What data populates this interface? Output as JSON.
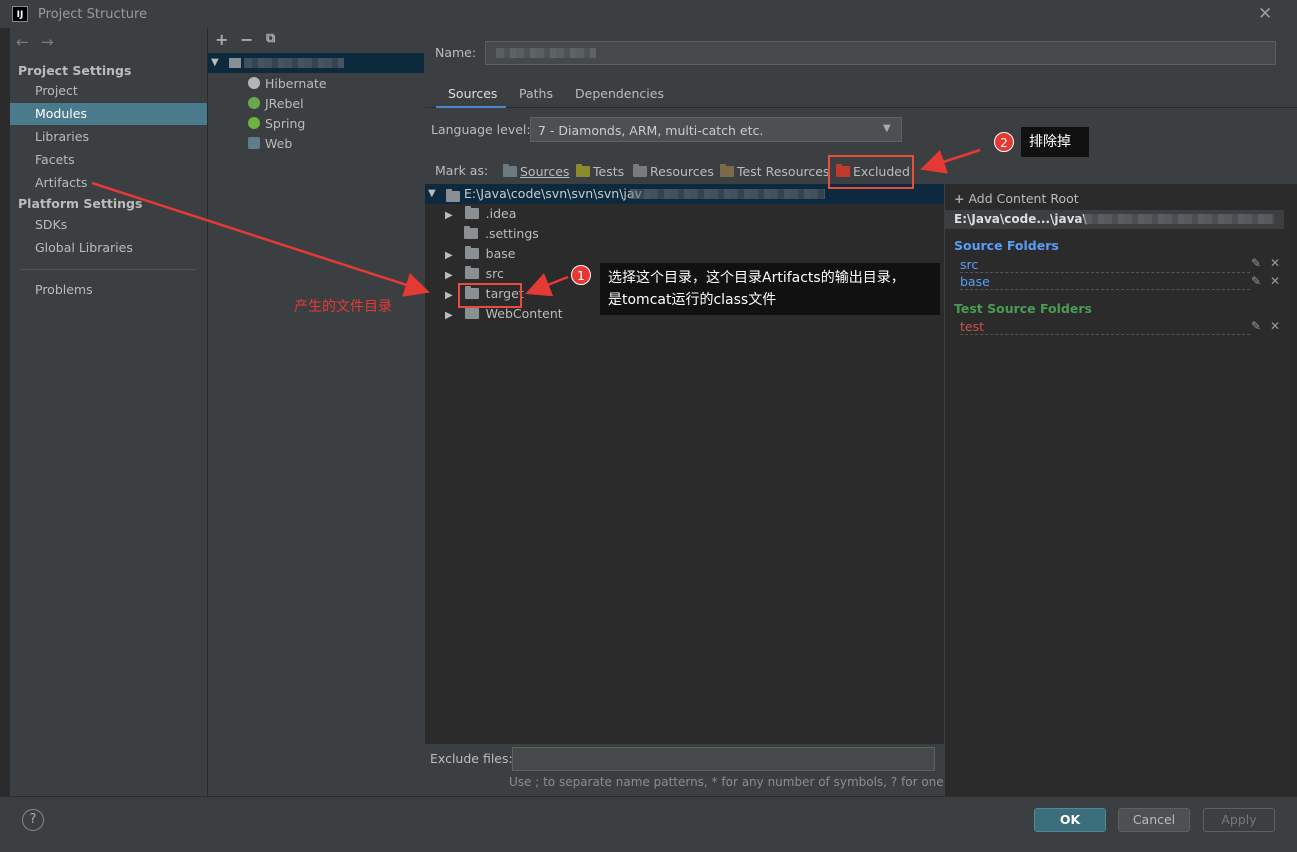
{
  "window": {
    "title": "Project Structure",
    "logo_text": "IJ",
    "close_glyph": "✕"
  },
  "nav": {
    "back_glyph": "←",
    "forward_glyph": "→",
    "project_settings_header": "Project Settings",
    "project_items": [
      "Project",
      "Modules",
      "Libraries",
      "Facets",
      "Artifacts"
    ],
    "platform_settings_header": "Platform Settings",
    "platform_items": [
      "SDKs",
      "Global Libraries"
    ],
    "problems": "Problems",
    "selected": "Modules"
  },
  "modules_panel": {
    "add_glyph": "+",
    "remove_glyph": "−",
    "copy_glyph": "⧉",
    "facets": [
      "Hibernate",
      "JRebel",
      "Spring",
      "Web"
    ]
  },
  "details": {
    "name_label": "Name:",
    "tabs": [
      "Sources",
      "Paths",
      "Dependencies"
    ],
    "active_tab": "Sources",
    "language_level_label": "Language level:",
    "language_level_value": "7 - Diamonds, ARM, multi-catch etc.",
    "mark_as_label": "Mark as:",
    "mark_as": {
      "sources": "Sources",
      "tests": "Tests",
      "resources": "Resources",
      "test_resources": "Test Resources",
      "excluded": "Excluded"
    },
    "tree": {
      "root": "E:\\Java\\code\\svn\\svn\\svn\\jav",
      "children": [
        ".idea",
        ".settings",
        "base",
        "src",
        "target",
        "WebContent"
      ]
    },
    "exclude_files_label": "Exclude files:",
    "exclude_files_hint": "Use ; to separate name patterns, * for any number of symbols, ? for one."
  },
  "content_roots": {
    "add_content_root": "Add Content Root",
    "root_path": "E:\\Java\\code...\\java\\",
    "source_folders_header": "Source Folders",
    "source_folders": [
      "src",
      "base"
    ],
    "test_source_folders_header": "Test Source Folders",
    "test_source_folders": [
      "test"
    ]
  },
  "buttons": {
    "ok": "OK",
    "cancel": "Cancel",
    "apply": "Apply",
    "help": "?"
  },
  "annotations": {
    "badge1": "1",
    "badge2": "2",
    "callout1_line1": "选择这个目录，这个目录Artifacts的输出目录，",
    "callout1_line2": "是tomcat运行的class文件",
    "callout2": "排除掉",
    "red_label": "产生的文件目录"
  },
  "colors": {
    "accent_selection": "#4a7b8c",
    "ok_button": "#3b6e7a",
    "source_blue": "#589df6",
    "test_green": "#499c54",
    "excluded_red": "#c0392b",
    "annotation_red": "#e53935"
  }
}
